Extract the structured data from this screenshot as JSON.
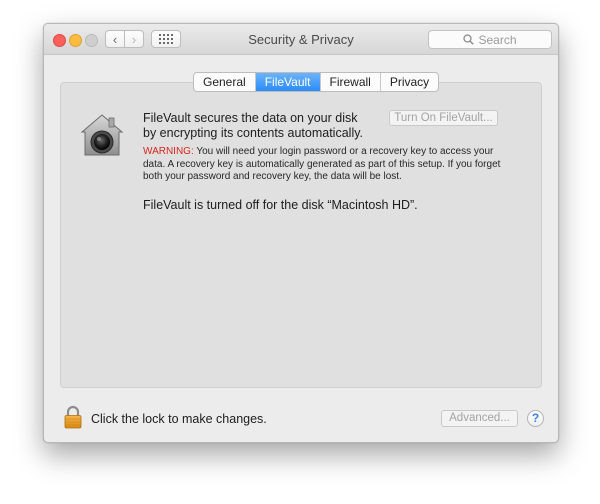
{
  "window": {
    "title": "Security & Privacy"
  },
  "toolbar": {
    "back_glyph": "‹",
    "forward_glyph": "›",
    "back_icon": "chevron-left-icon",
    "forward_icon": "chevron-right-icon",
    "show_all_icon": "grid-icon"
  },
  "search": {
    "placeholder": "Search",
    "icon": "search-icon"
  },
  "tabs": [
    {
      "label": "General",
      "active": false
    },
    {
      "label": "FileVault",
      "active": true
    },
    {
      "label": "Firewall",
      "active": false
    },
    {
      "label": "Privacy",
      "active": false
    }
  ],
  "filevault": {
    "icon": "filevault-house-icon",
    "description": "FileVault secures the data on your disk by encrypting its contents automatically.",
    "turn_on_button": "Turn On FileVault...",
    "warning_label": "WARNING:",
    "warning_text": " You will need your login password or a recovery key to access your data. A recovery key is automatically generated as part of this setup. If you forget both your password and recovery key, the data will be lost.",
    "status": "FileVault is turned off for the disk “Macintosh HD”."
  },
  "footer": {
    "lock_icon": "lock-icon",
    "lock_text": "Click the lock to make changes.",
    "advanced_button": "Advanced...",
    "help_label": "?"
  },
  "colors": {
    "accent": "#2a8cf7",
    "warning": "#d6261c",
    "close": "#fc605b",
    "minimize": "#fdbc40"
  }
}
